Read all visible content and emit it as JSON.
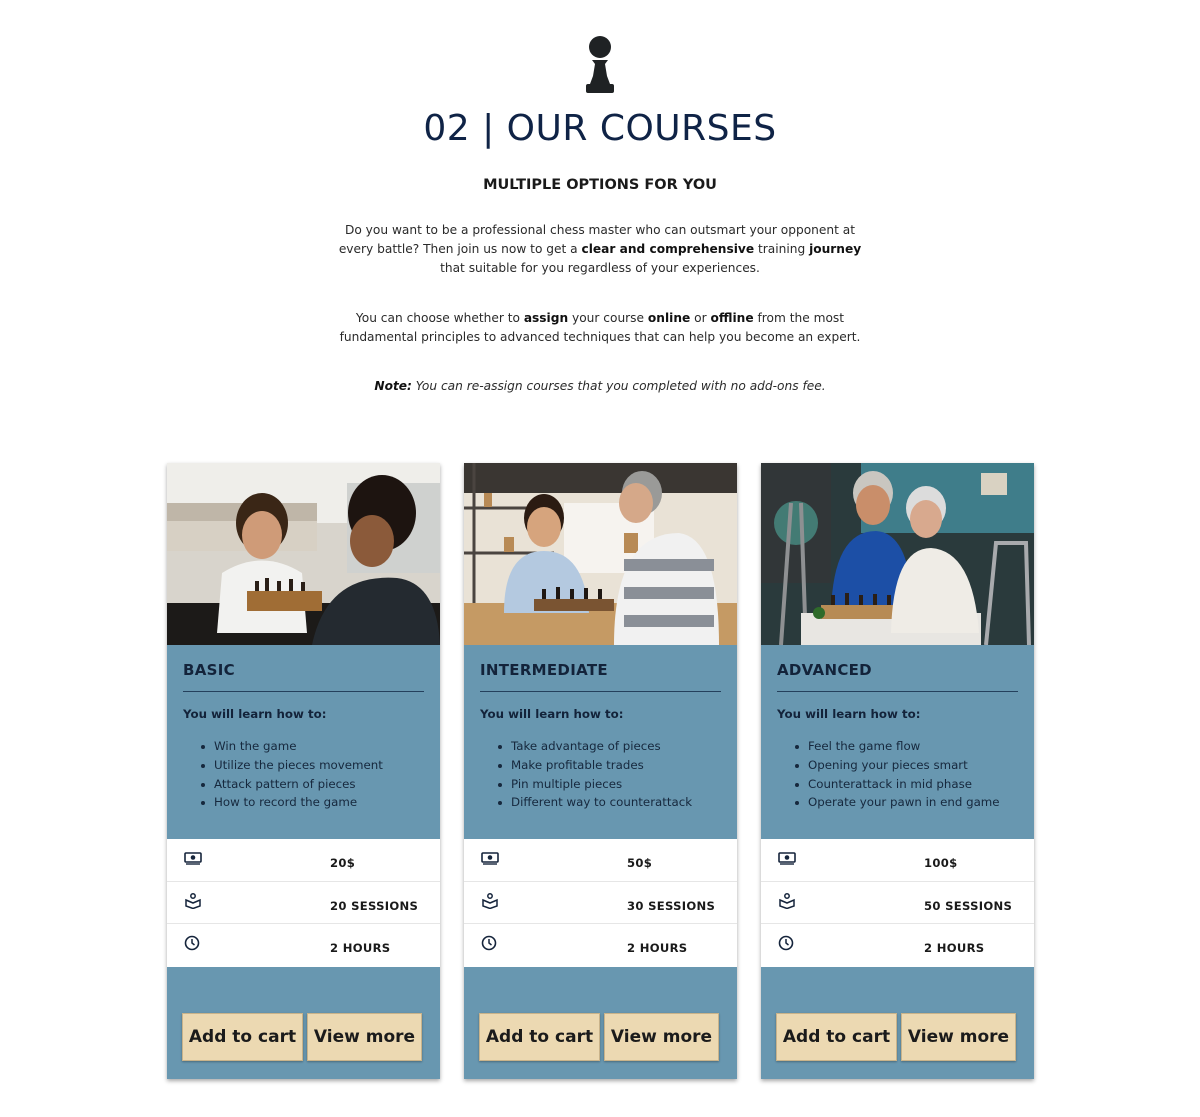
{
  "header": {
    "title": "02 | OUR COURSES",
    "subtitle": "MULTIPLE OPTIONS FOR YOU",
    "para1": {
      "t1": "Do you want to be a professional chess master who can outsmart your opponent at every battle? Then join us now to get a ",
      "b1": "clear and comprehensive",
      "t2": " training ",
      "b2": "journey",
      "t3": " that suitable for you regardless of your experiences."
    },
    "para2": {
      "t1": "You can choose whether to ",
      "b1": "assign",
      "t2": " your course ",
      "b2": "online",
      "t3": " or ",
      "b3": "offline",
      "t4": " from the most fundamental principles to advanced techniques that can help you become an expert."
    },
    "note": {
      "label": "Note:",
      "text": " You can re-assign courses that you completed with no add-ons fee."
    }
  },
  "courses": [
    {
      "level": "BASIC",
      "learn_label": "You will learn how to:",
      "items": [
        "Win the game",
        "Utilize the pieces movement",
        "Attack pattern of pieces",
        "How to record the game"
      ],
      "price": "20$",
      "sessions": "20 SESSIONS",
      "hours": "2 HOURS",
      "add_label": "Add to cart",
      "more_label": "View more"
    },
    {
      "level": "INTERMEDIATE",
      "learn_label": "You will learn how to:",
      "items": [
        "Take advantage of pieces",
        "Make profitable trades",
        "Pin multiple pieces",
        "Different way to counterattack"
      ],
      "price": "50$",
      "sessions": "30 SESSIONS",
      "hours": "2 HOURS",
      "add_label": "Add to cart",
      "more_label": "View more"
    },
    {
      "level": "ADVANCED",
      "learn_label": "You will learn how to:",
      "items": [
        "Feel the game flow",
        "Opening your pieces smart",
        "Counterattack in mid phase",
        "Operate your pawn in end game"
      ],
      "price": "100$",
      "sessions": "50 SESSIONS",
      "hours": "2 HOURS",
      "add_label": "Add to cart",
      "more_label": "View more"
    }
  ],
  "icons": {
    "logo": "chess-pawn-icon",
    "price": "money-bill-icon",
    "sessions": "book-reader-icon",
    "hours": "clock-icon"
  },
  "colors": {
    "heading": "#0f2346",
    "card": "#6897b0",
    "button": "#ecd9b2"
  }
}
